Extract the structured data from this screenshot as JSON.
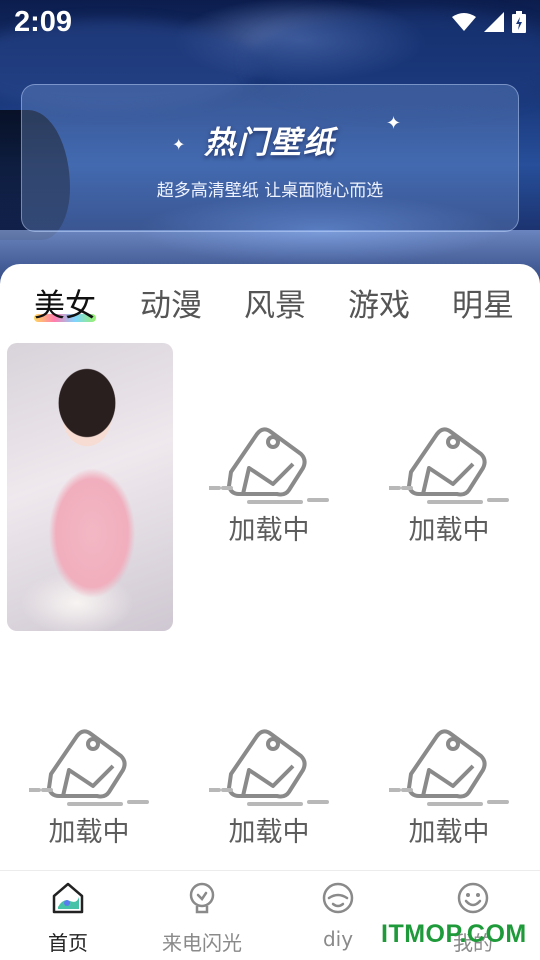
{
  "status_bar": {
    "time": "2:09"
  },
  "banner": {
    "title": "热门壁纸",
    "subtitle": "超多高清壁纸 让桌面随心而选"
  },
  "tabs": [
    {
      "label": "美女",
      "active": true
    },
    {
      "label": "动漫",
      "active": false
    },
    {
      "label": "风景",
      "active": false
    },
    {
      "label": "游戏",
      "active": false
    },
    {
      "label": "明星",
      "active": false
    }
  ],
  "grid": {
    "loading_text": "加载中"
  },
  "bottom_nav": [
    {
      "label": "首页",
      "icon": "home-icon",
      "active": true
    },
    {
      "label": "来电闪光",
      "icon": "lightbulb-icon",
      "active": false
    },
    {
      "label": "diy",
      "icon": "diy-face-icon",
      "active": false
    },
    {
      "label": "我的",
      "icon": "smile-face-icon",
      "active": false
    }
  ],
  "watermark": "ITMOP.COM",
  "colors": {
    "active_tab_underline": [
      "#ffd24a",
      "#ff6fa6",
      "#6fd1ff",
      "#8df05a"
    ],
    "home_icon_accent": "#46c2a8",
    "watermark": "#1f9a3a"
  }
}
